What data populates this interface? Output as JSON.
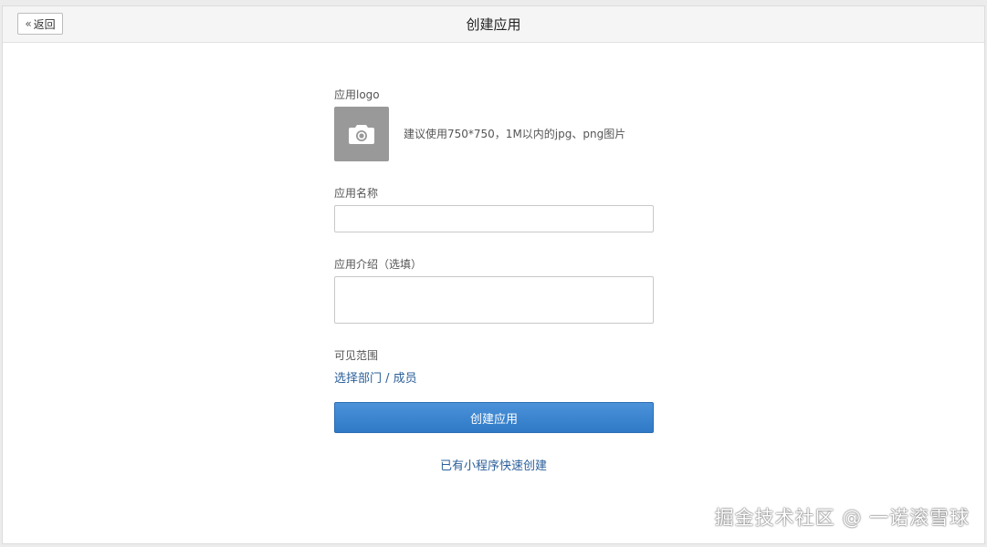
{
  "header": {
    "back_label": "返回",
    "title": "创建应用"
  },
  "form": {
    "logo_label": "应用logo",
    "logo_hint": "建议使用750*750，1M以内的jpg、png图片",
    "logo_icon": "camera-icon",
    "name_label": "应用名称",
    "name_value": "",
    "intro_label": "应用介绍（选填）",
    "intro_value": "",
    "scope_label": "可见范围",
    "scope_link": "选择部门 / 成员",
    "submit_label": "创建应用",
    "mini_program_link": "已有小程序快速创建"
  },
  "watermark": "掘金技术社区 @ 一诺滚雪球",
  "colors": {
    "accent": "#3a86d1",
    "link": "#2b5f99",
    "logo_bg": "#999999"
  }
}
